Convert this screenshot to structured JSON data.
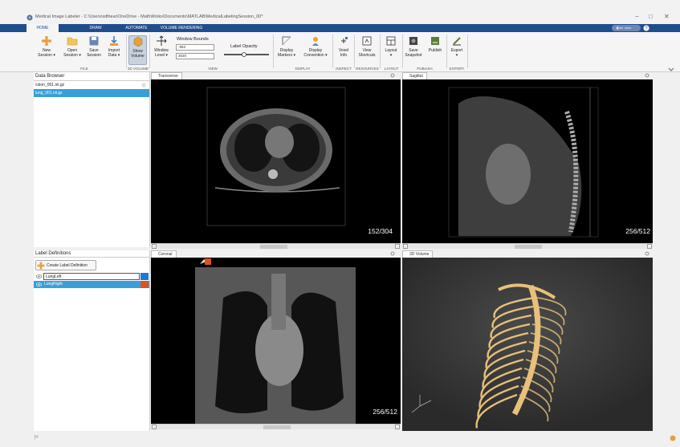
{
  "window": {
    "title": "Medical Image Labeler - C:\\Users\\sdlhear\\OneDrive - MathWorks\\Documents\\MATLAB\\MedicalLabelingSession_00*",
    "minimize": "−",
    "maximize": "□",
    "close": "✕"
  },
  "tabs": [
    "HOME",
    "DRAW",
    "AUTOMATE",
    "VOLUME RENDERING"
  ],
  "ribbon": {
    "new_session": [
      "New",
      "Session ▾"
    ],
    "open_session": [
      "Open",
      "Session ▾"
    ],
    "save_session": [
      "Save",
      "Session"
    ],
    "import_data": [
      "Import",
      "Data ▾"
    ],
    "show_volume": [
      "Show",
      "Volume"
    ],
    "window_level": [
      "Window",
      "Level ▾"
    ],
    "window_bounds_label": "Window Bounds",
    "window_bounds_min": "-983",
    "window_bounds_max": "3020",
    "label_opacity": "Label Opacity",
    "label_opacity_value": 0.45,
    "display_markers": [
      "Display",
      "Markers ▾"
    ],
    "display_convention": [
      "Display",
      "Convention ▾"
    ],
    "voxel_info": [
      "Voxel",
      "Info"
    ],
    "view_shortcuts": [
      "View",
      "Shortcuts"
    ],
    "layout": [
      "Layout",
      "▾"
    ],
    "save_snapshot": [
      "Save",
      "Snapshot"
    ],
    "publish": "Publish",
    "export": [
      "Export",
      "▾"
    ],
    "groups": {
      "file": "FILE",
      "volume3d": "3D VOLUME",
      "view": "VIEW",
      "display": "DISPLAY",
      "inspect": "INSPECT",
      "resources": "RESOURCES",
      "layout": "LAYOUT",
      "publish": "PUBLISH",
      "export": "EXPORT"
    }
  },
  "data_browser": {
    "title": "Data Browser",
    "items": [
      "colon_001.nii.gz",
      "lung_001.nii.gz"
    ],
    "selected_index": 1
  },
  "label_definitions": {
    "title": "Label Definitions",
    "create_button": "Create Label Definition",
    "labels": [
      {
        "name": "LungLeft",
        "color": "#1f77d4"
      },
      {
        "name": "LungRight",
        "color": "#d9541e"
      }
    ]
  },
  "views": {
    "transverse": {
      "tab": "Transverse",
      "slice": "152/304"
    },
    "sagittal": {
      "tab": "Sagittal",
      "slice": "256/512"
    },
    "coronal": {
      "tab": "Coronal",
      "slice": "256/512"
    },
    "volume": {
      "tab": "3D Volume"
    }
  },
  "colors": {
    "accent": "#1e4e8c",
    "selection": "#3a9fd8",
    "bone": "#e8c07a"
  }
}
